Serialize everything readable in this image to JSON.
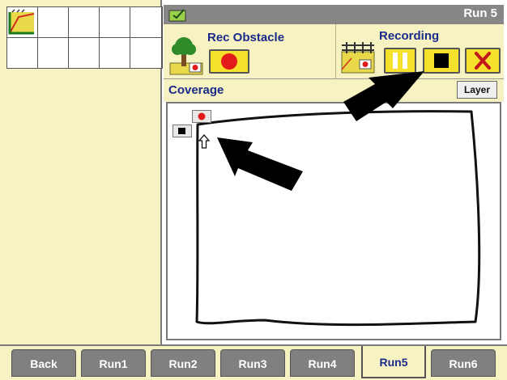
{
  "left_panel": {
    "grid_icon": "field-map-icon"
  },
  "header": {
    "title": "Run 5",
    "status_icon": "display-indicator-icon"
  },
  "obstacle": {
    "label": "Rec Obstacle",
    "icon": "tree-obstacle-icon",
    "record_button_icon": "red-record-icon"
  },
  "recording": {
    "label": "Recording",
    "icon": "fence-boundary-icon",
    "pause_icon": "pause-icon",
    "stop_icon": "stop-icon",
    "cancel_icon": "red-x-icon"
  },
  "coverage": {
    "label": "Coverage",
    "layer_button": "Layer"
  },
  "map": {
    "record_marker_icon": "red-record-icon",
    "stop_marker_icon": "stop-icon",
    "position_icon": "up-arrow-icon"
  },
  "tabs": [
    {
      "label": "Back",
      "active": false
    },
    {
      "label": "Run1",
      "active": false
    },
    {
      "label": "Run2",
      "active": false
    },
    {
      "label": "Run3",
      "active": false
    },
    {
      "label": "Run4",
      "active": false
    },
    {
      "label": "Run5",
      "active": true
    },
    {
      "label": "Run6",
      "active": false
    }
  ],
  "colors": {
    "panel_bg": "#f7f2c1",
    "header_bg": "#878787",
    "button_yellow": "#f5e02c",
    "label_blue": "#1a2a8c",
    "record_red": "#e21b1b"
  }
}
